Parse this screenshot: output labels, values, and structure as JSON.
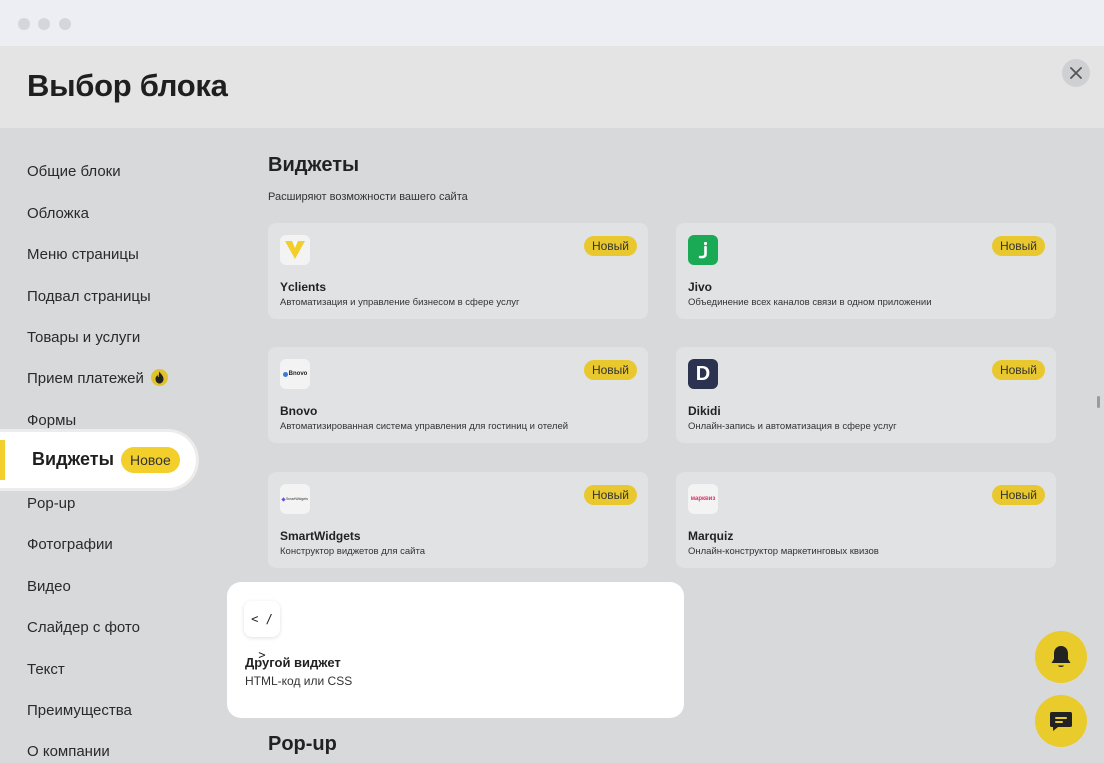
{
  "title": "Выбор блока",
  "sidebar": {
    "items": [
      {
        "label": "Общие блоки"
      },
      {
        "label": "Обложка"
      },
      {
        "label": "Меню страницы"
      },
      {
        "label": "Подвал страницы"
      },
      {
        "label": "Товары и услуги"
      },
      {
        "label": "Прием платежей",
        "icon": "fire-icon"
      },
      {
        "label": "Формы"
      },
      {
        "label": "Виджеты",
        "active": true,
        "badge": "Новое"
      },
      {
        "label": "Pop-up"
      },
      {
        "label": "Фотографии"
      },
      {
        "label": "Видео"
      },
      {
        "label": "Слайдер с фото"
      },
      {
        "label": "Текст"
      },
      {
        "label": "Преимущества"
      },
      {
        "label": "О компании"
      }
    ]
  },
  "section": {
    "title": "Виджеты",
    "subtitle": "Расширяют возможности вашего сайта",
    "next_title": "Pop-up"
  },
  "widgets": [
    {
      "name": "Yclients",
      "desc": "Автоматизация и управление бизнесом в сфере услуг",
      "badge": "Новый",
      "icon": "yclients-logo-icon"
    },
    {
      "name": "Jivo",
      "desc": "Объединение всех каналов связи в одном приложении",
      "badge": "Новый",
      "icon": "jivo-logo-icon"
    },
    {
      "name": "Bnovo",
      "desc": "Автоматизированная система управления для гостиниц и отелей",
      "badge": "Новый",
      "icon": "bnovo-logo-icon",
      "logo_text": "Bnovo"
    },
    {
      "name": "Dikidi",
      "desc": "Онлайн-запись и автоматизация в сфере услуг",
      "badge": "Новый",
      "icon": "dikidi-logo-icon",
      "logo_text": "D"
    },
    {
      "name": "SmartWidgets",
      "desc": "Конструктор виджетов для сайта",
      "badge": "Новый",
      "icon": "smartwidgets-logo-icon",
      "logo_text": "SmartWidgets"
    },
    {
      "name": "Marquiz",
      "desc": "Онлайн-конструктор маркетинговых квизов",
      "badge": "Новый",
      "icon": "marquiz-logo-icon",
      "logo_text": "марквиз"
    }
  ],
  "other_widget": {
    "name": "Другой виджет",
    "desc": "HTML-код или CSS",
    "icon_text": "< / >"
  },
  "fabs": [
    "bell-icon",
    "chat-icon"
  ],
  "colors": {
    "accent": "#f2cf2a",
    "jivo": "#1aaa55",
    "dikidi": "#2c3350",
    "marquiz": "#d6336c"
  }
}
